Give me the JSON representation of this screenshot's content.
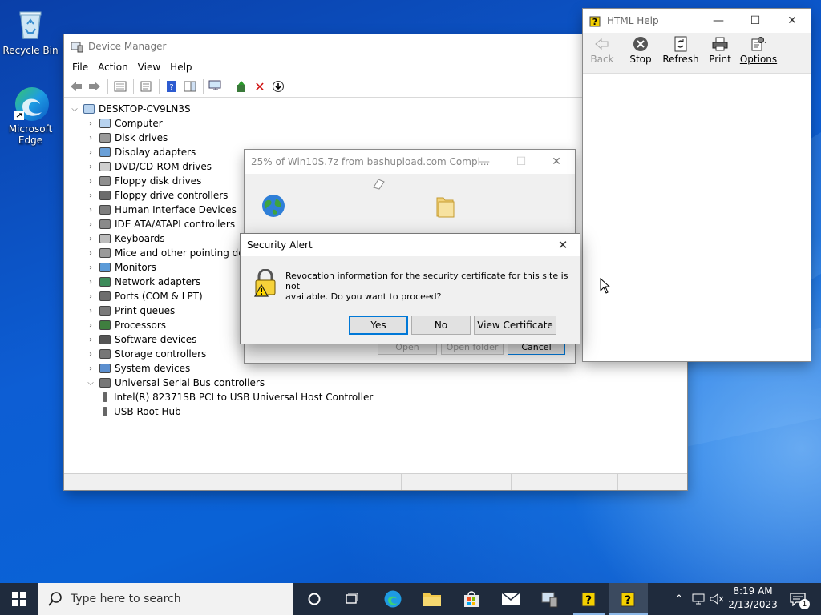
{
  "desktop": {
    "icons": [
      {
        "label": "Recycle Bin"
      },
      {
        "label": "Microsoft Edge"
      }
    ]
  },
  "device_manager": {
    "title": "Device Manager",
    "menu": [
      "File",
      "Action",
      "View",
      "Help"
    ],
    "root": "DESKTOP-CV9LN3S",
    "categories": [
      "Computer",
      "Disk drives",
      "Display adapters",
      "DVD/CD-ROM drives",
      "Floppy disk drives",
      "Floppy drive controllers",
      "Human Interface Devices",
      "IDE ATA/ATAPI controllers",
      "Keyboards",
      "Mice and other pointing devi",
      "Monitors",
      "Network adapters",
      "Ports (COM & LPT)",
      "Print queues",
      "Processors",
      "Software devices",
      "Storage controllers",
      "System devices",
      "Universal Serial Bus controllers"
    ],
    "usb_children": [
      "Intel(R) 82371SB PCI to USB Universal Host Controller",
      "USB Root Hub"
    ]
  },
  "download": {
    "title": "25% of Win10S.7z from bashupload.com Compl...",
    "buttons": {
      "open": "Open",
      "open_folder": "Open folder",
      "cancel": "Cancel"
    }
  },
  "html_help": {
    "title": "HTML Help",
    "buttons": {
      "back": "Back",
      "stop": "Stop",
      "refresh": "Refresh",
      "print": "Print",
      "options": "Options"
    }
  },
  "security_alert": {
    "title": "Security Alert",
    "message_line1": "Revocation information for the security certificate for this site is not",
    "message_line2": "available. Do you want to proceed?",
    "buttons": {
      "yes": "Yes",
      "no": "No",
      "view_certificate": "View Certificate"
    }
  },
  "taskbar": {
    "search_placeholder": "Type here to search",
    "time": "8:19 AM",
    "date": "2/13/2023",
    "notification_count": "1"
  },
  "colors": {
    "taskbar": "#1f2b3d",
    "accent": "#0078d7",
    "desktop": "#0d5ed4"
  }
}
